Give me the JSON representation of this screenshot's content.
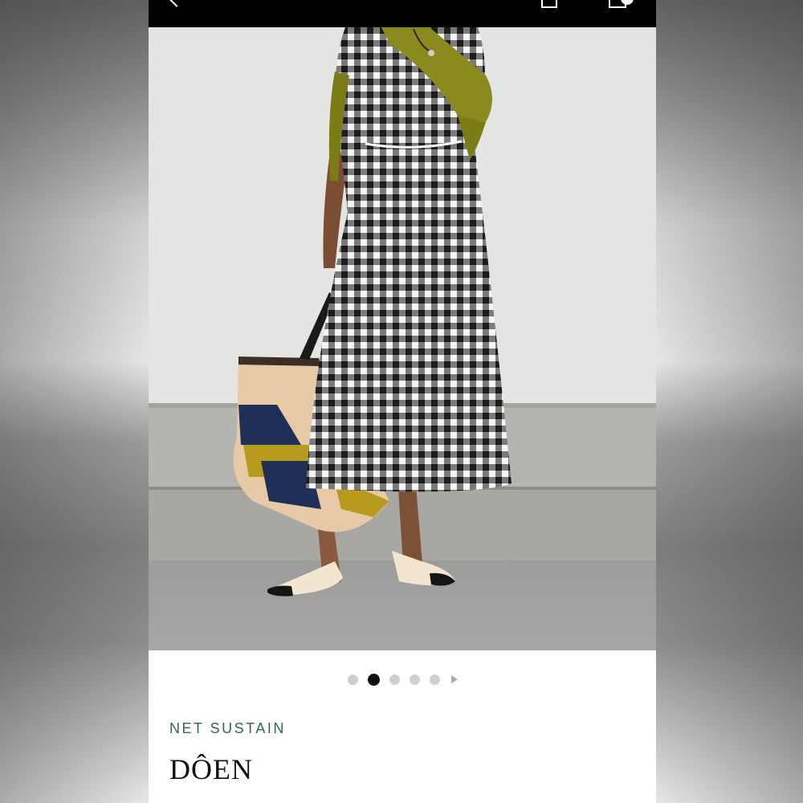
{
  "product": {
    "tag": "NET SUSTAIN",
    "brand": "DÔEN"
  },
  "gallery": {
    "image_count": 5,
    "active_index": 2
  },
  "icons": {
    "back": "chevron-left-icon",
    "share": "share-icon",
    "bag": "shopping-bag-icon",
    "next": "play-arrow-icon"
  },
  "colors": {
    "topbar": "#000000",
    "tag": "#2f6b45",
    "active_dot": "#111111",
    "inactive_dot": "#cfcfcf"
  }
}
